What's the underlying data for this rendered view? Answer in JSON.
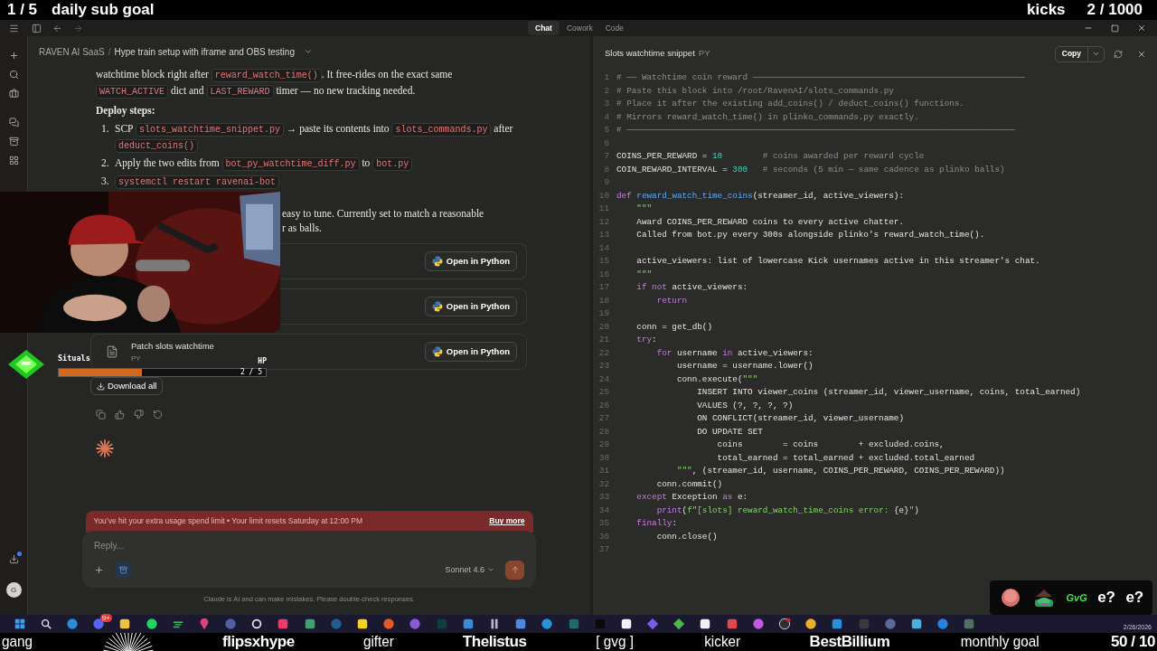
{
  "overlay_top": {
    "left_count": "1 / 5",
    "left_label": "daily sub goal",
    "right_label": "kicks",
    "right_count": "2 / 1000"
  },
  "tabs": [
    {
      "label": "Chat",
      "selected": true
    },
    {
      "label": "Cowork",
      "selected": false
    },
    {
      "label": "Code",
      "selected": false
    }
  ],
  "breadcrumb": {
    "project": "RAVEN AI SaaS",
    "separator": "/",
    "chat_title": "Hype train setup with iframe and OBS testing"
  },
  "sidebar": {
    "download_badge": true,
    "avatar": "G"
  },
  "message": {
    "intro": [
      {
        "kind": "text",
        "text": "watchtime block right after "
      },
      {
        "kind": "code",
        "text": "reward_watch_time()"
      },
      {
        "kind": "text",
        "text": ". It free-rides on the exact same "
      },
      {
        "kind": "code",
        "text": "WATCH_ACTIVE"
      },
      {
        "kind": "text",
        "text": " dict and "
      },
      {
        "kind": "code",
        "text": "LAST_REWARD"
      },
      {
        "kind": "text",
        "text": " timer — no new tracking needed."
      }
    ],
    "heading": "Deploy steps:",
    "steps": [
      {
        "number": "1.",
        "parts": [
          {
            "kind": "text",
            "text": "SCP "
          },
          {
            "kind": "code",
            "text": "slots_watchtime_snippet.py"
          },
          {
            "kind": "text",
            "text": " → paste its contents into "
          },
          {
            "kind": "code",
            "text": "slots_commands.py"
          },
          {
            "kind": "text",
            "text": " after "
          },
          {
            "kind": "code",
            "text": "deduct_coins()"
          }
        ]
      },
      {
        "number": "2.",
        "parts": [
          {
            "kind": "text",
            "text": "Apply the two edits from "
          },
          {
            "kind": "code",
            "text": "bot_py_watchtime_diff.py"
          },
          {
            "kind": "text",
            "text": " to "
          },
          {
            "kind": "code",
            "text": "bot.py"
          }
        ]
      },
      {
        "number": "3.",
        "parts": [
          {
            "kind": "code",
            "text": "systemctl restart ravenai-bot"
          }
        ]
      }
    ],
    "fragments": [
      "easy to tune. Currently set to match a reasonable",
      "r as balls."
    ],
    "files": [
      {
        "button": "Open in Python"
      },
      {
        "button": "Open in Python"
      },
      {
        "title": "Patch slots watchtime",
        "type": "PY",
        "button": "Open in Python"
      }
    ],
    "download_all": "Download all"
  },
  "widget": {
    "name": "Situals",
    "tag": "HP",
    "level": 0.4,
    "count": "2 / 5"
  },
  "banner": {
    "message": "You’ve hit your extra usage spend limit • Your limit resets Saturday at 12:00 PM",
    "action": "Buy more"
  },
  "composer": {
    "placeholder": "Reply...",
    "model": "Sonnet 4.6"
  },
  "disclaimer": "Claude is AI and can make mistakes. Please double-check responses.",
  "panel": {
    "title": "Slots watchtime snippet",
    "type": "PY",
    "copy": "Copy",
    "lines": [
      {
        "n": "1",
        "t": [
          {
            "kind": "c",
            "text": "# ── Watchtime coin reward ──────────────────────────────────────────────────────"
          }
        ]
      },
      {
        "n": "2",
        "t": [
          {
            "kind": "c",
            "text": "# Paste this block into /root/RavenAI/slots_commands.py"
          }
        ]
      },
      {
        "n": "3",
        "t": [
          {
            "kind": "c",
            "text": "# Place it after the existing add_coins() / deduct_coins() functions."
          }
        ]
      },
      {
        "n": "4",
        "t": [
          {
            "kind": "c",
            "text": "# Mirrors reward_watch_time() in plinko_commands.py exactly."
          }
        ]
      },
      {
        "n": "5",
        "t": [
          {
            "kind": "c",
            "text": "# ─────────────────────────────────────────────────────────────────────────────"
          }
        ]
      },
      {
        "n": "6"
      },
      {
        "n": "7",
        "t": [
          {
            "kind": "p",
            "text": "COINS_PER_REWARD = "
          },
          {
            "kind": "n",
            "text": "10"
          },
          {
            "kind": "c",
            "text": "        # coins awarded per reward cycle"
          }
        ]
      },
      {
        "n": "8",
        "t": [
          {
            "kind": "p",
            "text": "COIN_REWARD_INTERVAL = "
          },
          {
            "kind": "n",
            "text": "300"
          },
          {
            "kind": "c",
            "text": "   # seconds (5 min — same cadence as plinko balls)"
          }
        ]
      },
      {
        "n": "9"
      },
      {
        "n": "10",
        "t": [
          {
            "kind": "k",
            "text": "def "
          },
          {
            "kind": "f",
            "text": "reward_watch_time_coins"
          },
          {
            "kind": "p",
            "text": "(streamer_id, active_viewers):"
          }
        ]
      },
      {
        "n": "11",
        "t": [
          {
            "kind": "s",
            "text": "    \"\"\""
          }
        ]
      },
      {
        "n": "12",
        "t": [
          {
            "kind": "p",
            "text": "    Award COINS_PER_REWARD coins to every active chatter."
          }
        ]
      },
      {
        "n": "13",
        "t": [
          {
            "kind": "p",
            "text": "    Called from bot.py every 300s alongside plinko's reward_watch_time()."
          }
        ]
      },
      {
        "n": "14"
      },
      {
        "n": "15",
        "t": [
          {
            "kind": "p",
            "text": "    active_viewers: list of lowercase Kick usernames active in this streamer's chat."
          }
        ]
      },
      {
        "n": "16",
        "t": [
          {
            "kind": "s",
            "text": "    \"\"\""
          }
        ]
      },
      {
        "n": "17",
        "t": [
          {
            "kind": "k",
            "text": "    if not"
          },
          {
            "kind": "p",
            "text": " active_viewers:"
          }
        ]
      },
      {
        "n": "18",
        "t": [
          {
            "kind": "k",
            "text": "        return"
          }
        ]
      },
      {
        "n": "19"
      },
      {
        "n": "20",
        "t": [
          {
            "kind": "p",
            "text": "    conn = get_db()"
          }
        ]
      },
      {
        "n": "21",
        "t": [
          {
            "kind": "k",
            "text": "    try"
          },
          {
            "kind": "p",
            "text": ":"
          }
        ]
      },
      {
        "n": "22",
        "t": [
          {
            "kind": "k",
            "text": "        for"
          },
          {
            "kind": "p",
            "text": " username "
          },
          {
            "kind": "k",
            "text": "in"
          },
          {
            "kind": "p",
            "text": " active_viewers:"
          }
        ]
      },
      {
        "n": "23",
        "t": [
          {
            "kind": "p",
            "text": "            username = username.lower()"
          }
        ]
      },
      {
        "n": "24",
        "t": [
          {
            "kind": "p",
            "text": "            conn.execute("
          },
          {
            "kind": "s",
            "text": "\"\"\""
          }
        ]
      },
      {
        "n": "25",
        "t": [
          {
            "kind": "p",
            "text": "                INSERT INTO viewer_coins (streamer_id, viewer_username, coins, total_earned)"
          }
        ]
      },
      {
        "n": "26",
        "t": [
          {
            "kind": "p",
            "text": "                VALUES (?, ?, ?, ?)"
          }
        ]
      },
      {
        "n": "27",
        "t": [
          {
            "kind": "p",
            "text": "                ON CONFLICT(streamer_id, viewer_username)"
          }
        ]
      },
      {
        "n": "28",
        "t": [
          {
            "kind": "p",
            "text": "                DO UPDATE SET"
          }
        ]
      },
      {
        "n": "29",
        "t": [
          {
            "kind": "p",
            "text": "                    coins        = coins        + excluded.coins,"
          }
        ]
      },
      {
        "n": "30",
        "t": [
          {
            "kind": "p",
            "text": "                    total_earned = total_earned + excluded.total_earned"
          }
        ]
      },
      {
        "n": "31",
        "t": [
          {
            "kind": "s",
            "text": "            \"\"\""
          },
          {
            "kind": "p",
            "text": ", (streamer_id, username, COINS_PER_REWARD, COINS_PER_REWARD))"
          }
        ]
      },
      {
        "n": "32",
        "t": [
          {
            "kind": "p",
            "text": "        conn.commit()"
          }
        ]
      },
      {
        "n": "33",
        "t": [
          {
            "kind": "k",
            "text": "    except"
          },
          {
            "kind": "p",
            "text": " Exception "
          },
          {
            "kind": "k",
            "text": "as"
          },
          {
            "kind": "p",
            "text": " e:"
          }
        ]
      },
      {
        "n": "34",
        "t": [
          {
            "kind": "k",
            "text": "        print"
          },
          {
            "kind": "p",
            "text": "("
          },
          {
            "kind": "s",
            "text": "f\"[slots] reward_watch_time_coins error: "
          },
          {
            "kind": "p",
            "text": "{e}"
          },
          {
            "kind": "s",
            "text": "\""
          },
          {
            "kind": "p",
            "text": ")"
          }
        ]
      },
      {
        "n": "35",
        "t": [
          {
            "kind": "k",
            "text": "    finally"
          },
          {
            "kind": "p",
            "text": ":"
          }
        ]
      },
      {
        "n": "36",
        "t": [
          {
            "kind": "p",
            "text": "        conn.close()"
          }
        ]
      },
      {
        "n": "37"
      }
    ]
  },
  "taskbar": {
    "chat_badge": "9+",
    "date": "2/26/2026"
  },
  "emotes": [
    {
      "kind": "picture"
    },
    {
      "kind": "picture"
    },
    {
      "kind": "text",
      "text": "GvG"
    },
    {
      "kind": "text",
      "text": "e?"
    },
    {
      "kind": "text",
      "text": "e?"
    }
  ],
  "ticker": [
    {
      "kind": "label",
      "text": "gang"
    },
    {
      "kind": "graphic"
    },
    {
      "kind": "name",
      "text": "flipsxhype"
    },
    {
      "kind": "label",
      "text": "gifter"
    },
    {
      "kind": "name",
      "text": "Thelistus"
    },
    {
      "kind": "label",
      "text": "[ gvg ]"
    },
    {
      "kind": "label",
      "text": "kicker"
    },
    {
      "kind": "name",
      "text": "BestBillium"
    },
    {
      "kind": "label",
      "text": "monthly goal"
    },
    {
      "kind": "name",
      "text": "50 / 10"
    }
  ]
}
